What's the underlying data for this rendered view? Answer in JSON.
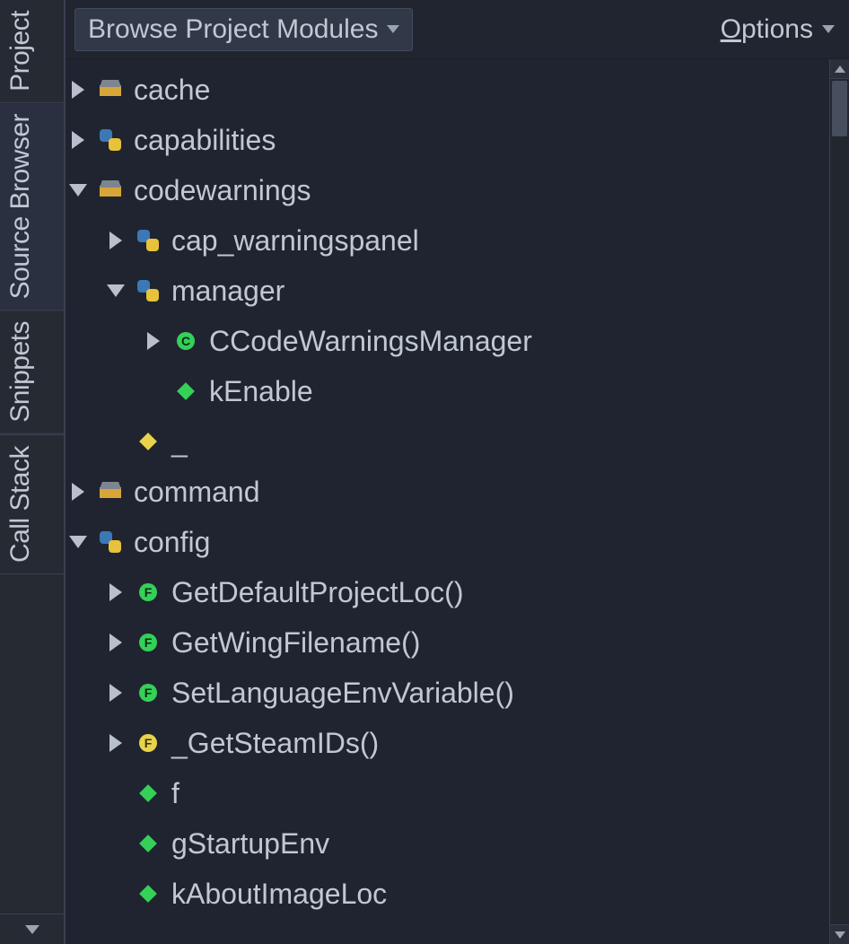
{
  "tabs": {
    "items": [
      "Project",
      "Source Browser",
      "Snippets",
      "Call Stack"
    ],
    "active_index": 1
  },
  "toolbar": {
    "combo_label": "Browse Project Modules",
    "options_label_pre": "O",
    "options_label_rest": "ptions"
  },
  "tree": [
    {
      "depth": 0,
      "disclosure": "closed",
      "icon": "package",
      "label": "cache"
    },
    {
      "depth": 0,
      "disclosure": "closed",
      "icon": "python",
      "label": "capabilities"
    },
    {
      "depth": 0,
      "disclosure": "open",
      "icon": "package",
      "label": "codewarnings"
    },
    {
      "depth": 1,
      "disclosure": "closed",
      "icon": "python",
      "label": "cap_warningspanel"
    },
    {
      "depth": 1,
      "disclosure": "open",
      "icon": "python",
      "label": "manager"
    },
    {
      "depth": 2,
      "disclosure": "closed",
      "icon": "class-green",
      "label": "CCodeWarningsManager"
    },
    {
      "depth": 2,
      "disclosure": "none",
      "icon": "diamond-green",
      "label": "kEnable"
    },
    {
      "depth": 1,
      "disclosure": "none",
      "icon": "diamond-yellow",
      "label": "_"
    },
    {
      "depth": 0,
      "disclosure": "closed",
      "icon": "package",
      "label": "command"
    },
    {
      "depth": 0,
      "disclosure": "open",
      "icon": "python",
      "label": "config"
    },
    {
      "depth": 1,
      "disclosure": "closed",
      "icon": "func-green",
      "label": "GetDefaultProjectLoc()"
    },
    {
      "depth": 1,
      "disclosure": "closed",
      "icon": "func-green",
      "label": "GetWingFilename()"
    },
    {
      "depth": 1,
      "disclosure": "closed",
      "icon": "func-green",
      "label": "SetLanguageEnvVariable()"
    },
    {
      "depth": 1,
      "disclosure": "closed",
      "icon": "func-yellow",
      "label": "_GetSteamIDs()"
    },
    {
      "depth": 1,
      "disclosure": "none",
      "icon": "diamond-green",
      "label": "f"
    },
    {
      "depth": 1,
      "disclosure": "none",
      "icon": "diamond-green",
      "label": "gStartupEnv"
    },
    {
      "depth": 1,
      "disclosure": "none",
      "icon": "diamond-green",
      "label": "kAboutImageLoc"
    }
  ]
}
